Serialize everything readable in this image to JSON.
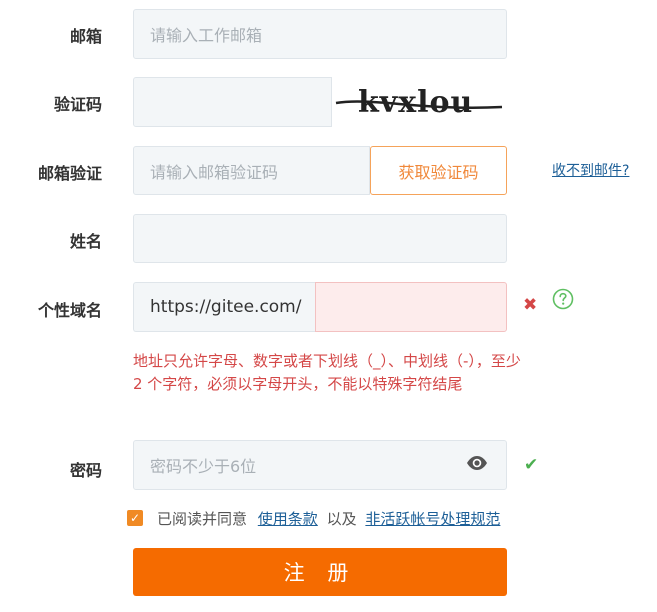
{
  "form": {
    "email": {
      "label": "邮箱",
      "placeholder": "请输入工作邮箱"
    },
    "captcha": {
      "label": "验证码",
      "image_text": "kvxlou"
    },
    "email_verify": {
      "label": "邮箱验证",
      "placeholder": "请输入邮箱验证码",
      "button_label": "获取验证码",
      "help_link": "收不到邮件?"
    },
    "name": {
      "label": "姓名"
    },
    "domain": {
      "label": "个性域名",
      "prefix": "https://gitee.com/",
      "error_icon": "close-icon",
      "help_icon": "question-circle-icon",
      "error_text": "地址只允许字母、数字或者下划线（_）、中划线（-），至少 2 个字符，必须以字母开头，不能以特殊字符结尾"
    },
    "password": {
      "label": "密码",
      "placeholder": "密码不少于6位",
      "eye_icon": "eye-icon",
      "valid_icon": "check-icon"
    },
    "agreement": {
      "checked": true,
      "prefix_text": "已阅读并同意",
      "terms_link": "使用条款",
      "joiner": "以及",
      "policy_link": "非活跃帐号处理规范"
    },
    "submit_label": "注 册"
  },
  "colors": {
    "accent": "#f56b00",
    "error": "#d44747",
    "success": "#4caf50",
    "link": "#1d5f97"
  }
}
